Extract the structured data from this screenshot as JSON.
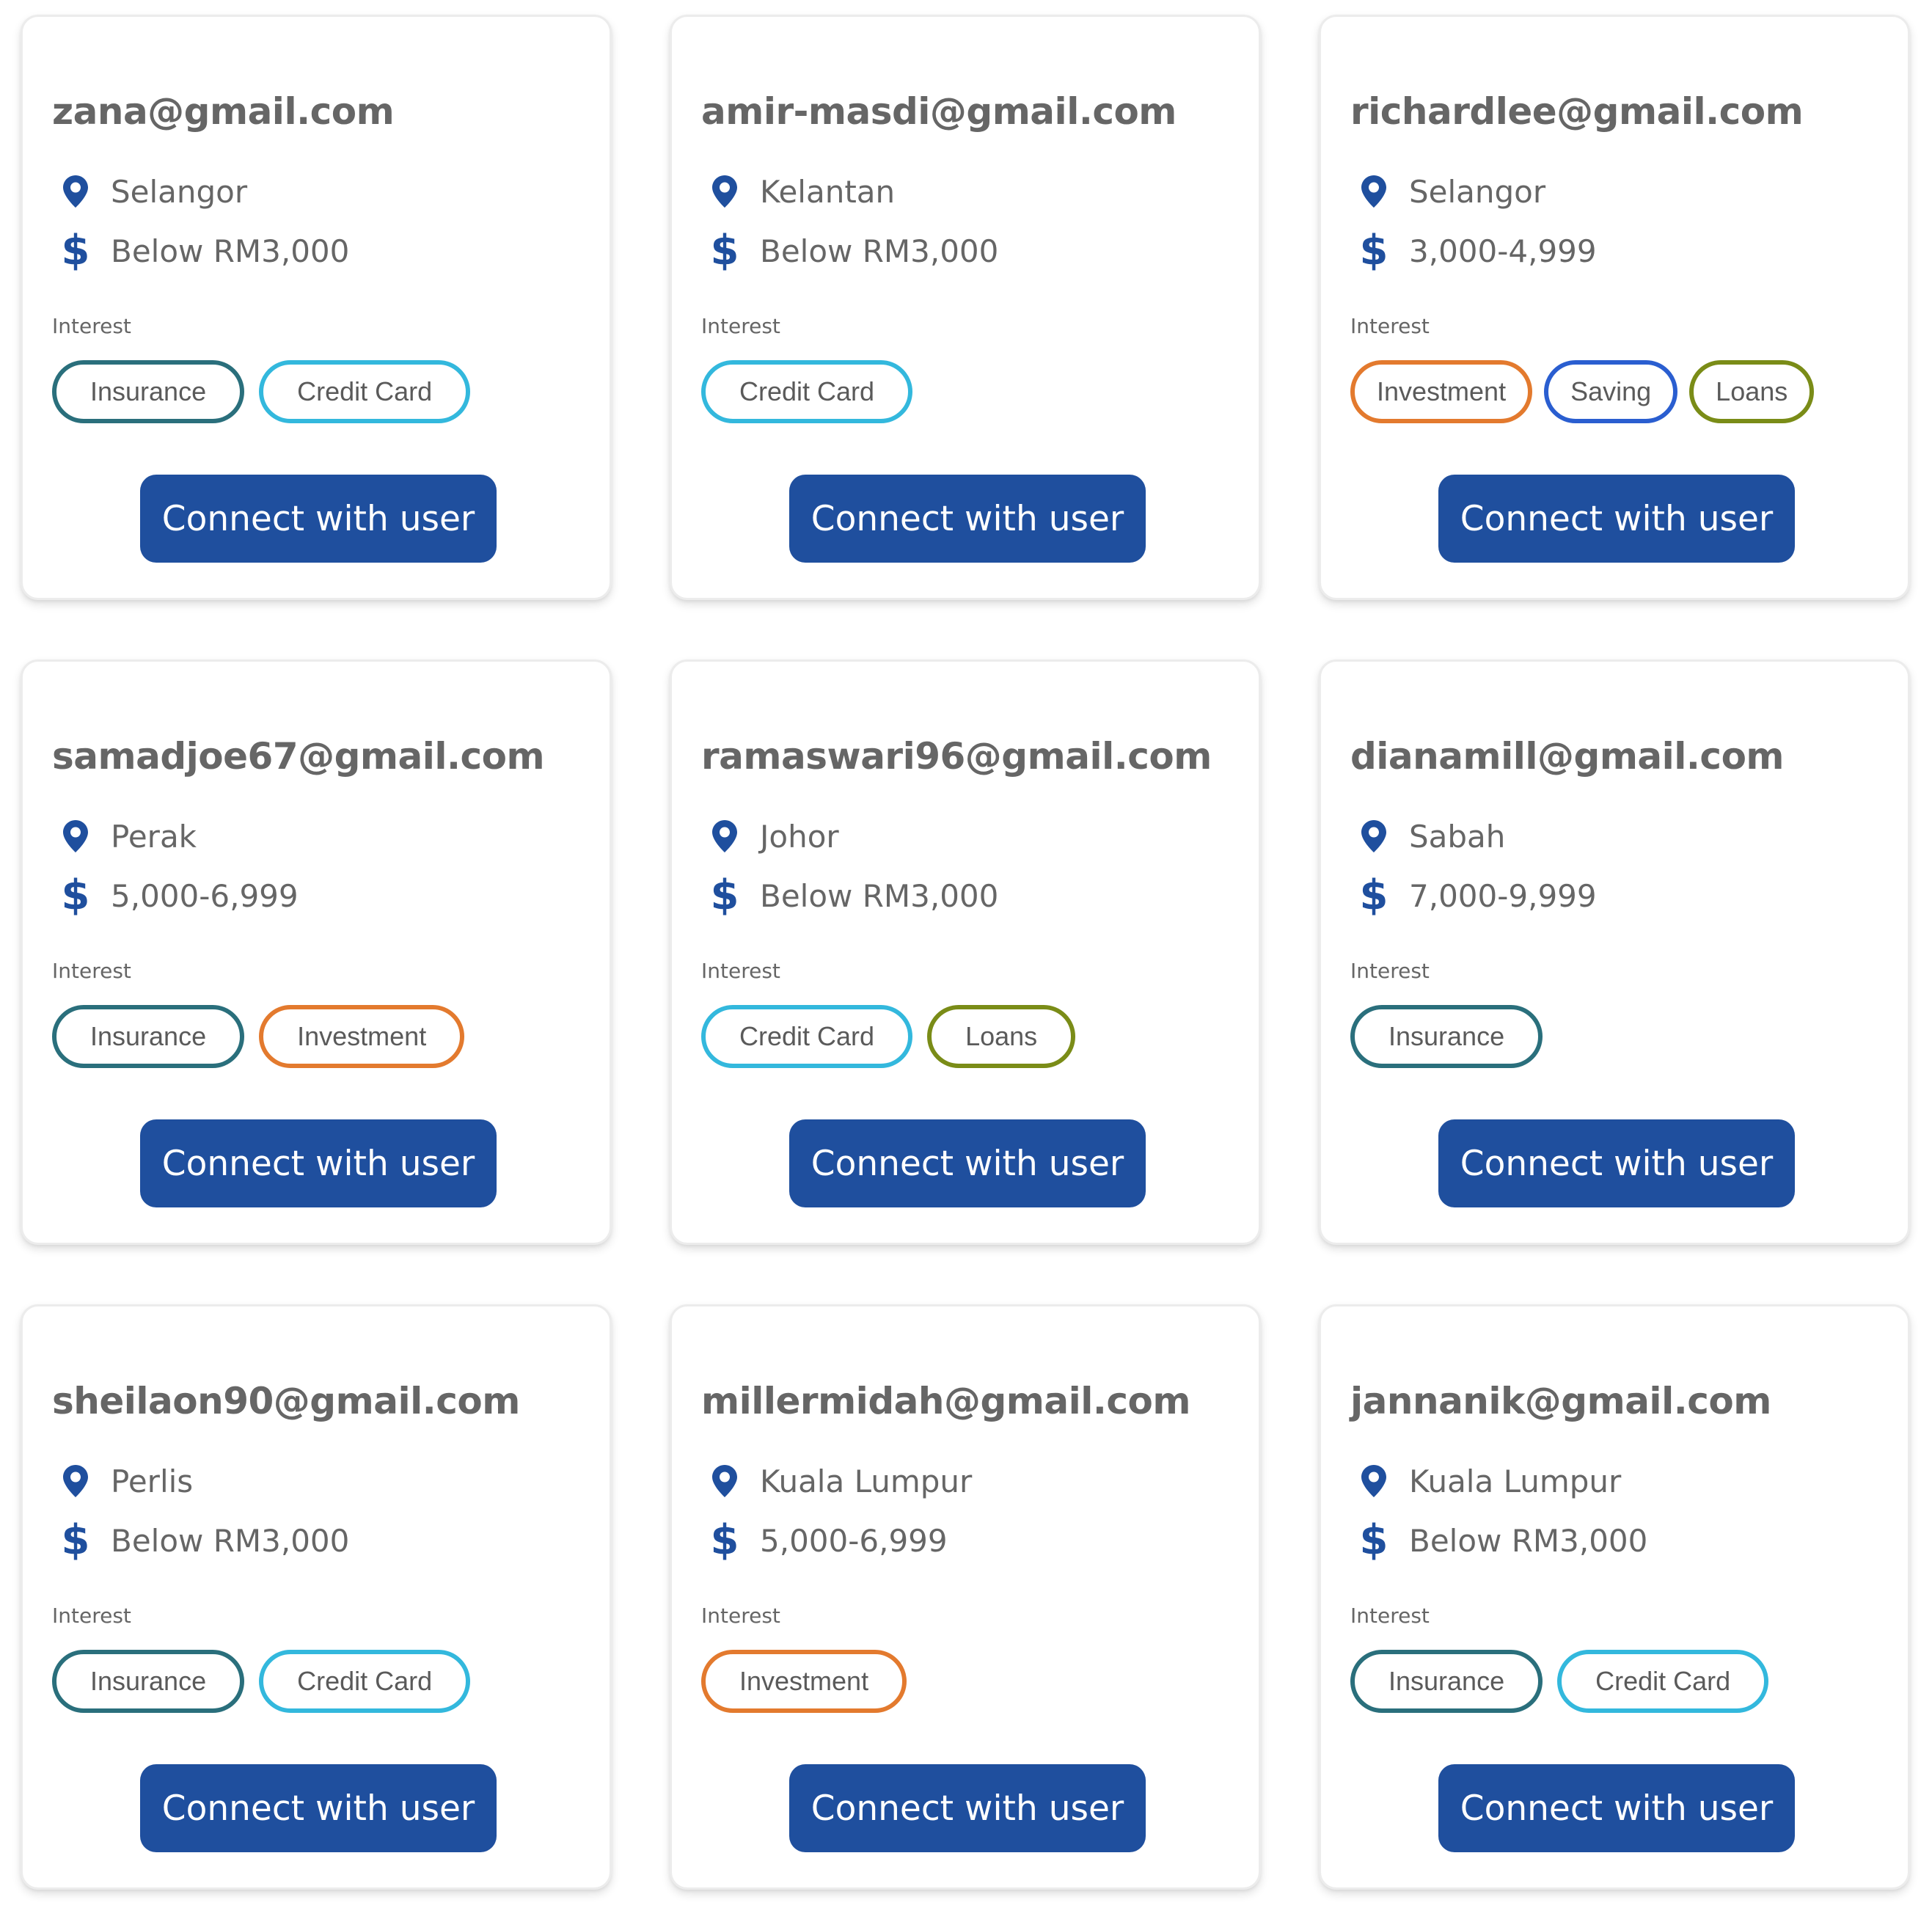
{
  "interest_label": "Interest",
  "connect_label": "Connect with user",
  "chip_colors": {
    "Insurance": "#2a6f7c",
    "Credit Card": "#33b8dd",
    "Investment": "#e37a2e",
    "Saving": "#2a5ed0",
    "Loans": "#7a8c17"
  },
  "accent_color": "#1f4f9e",
  "users": [
    {
      "email": "zana@gmail.com",
      "location": "Selangor",
      "income": "Below RM3,000",
      "interests": [
        "Insurance",
        "Credit Card"
      ]
    },
    {
      "email": "amir-masdi@gmail.com",
      "location": "Kelantan",
      "income": "Below RM3,000",
      "interests": [
        "Credit Card"
      ]
    },
    {
      "email": "richardlee@gmail.com",
      "location": "Selangor",
      "income": "3,000-4,999",
      "interests": [
        "Investment",
        "Saving",
        "Loans"
      ]
    },
    {
      "email": "samadjoe67@gmail.com",
      "location": "Perak",
      "income": "5,000-6,999",
      "interests": [
        "Insurance",
        "Investment"
      ]
    },
    {
      "email": "ramaswari96@gmail.com",
      "location": "Johor",
      "income": "Below RM3,000",
      "interests": [
        "Credit Card",
        "Loans"
      ]
    },
    {
      "email": "dianamill@gmail.com",
      "location": "Sabah",
      "income": "7,000-9,999",
      "interests": [
        "Insurance"
      ]
    },
    {
      "email": "sheilaon90@gmail.com",
      "location": "Perlis",
      "income": "Below RM3,000",
      "interests": [
        "Insurance",
        "Credit Card"
      ]
    },
    {
      "email": "millermidah@gmail.com",
      "location": "Kuala Lumpur",
      "income": "5,000-6,999",
      "interests": [
        "Investment"
      ]
    },
    {
      "email": "jannanik@gmail.com",
      "location": "Kuala Lumpur",
      "income": "Below RM3,000",
      "interests": [
        "Insurance",
        "Credit Card"
      ]
    }
  ]
}
